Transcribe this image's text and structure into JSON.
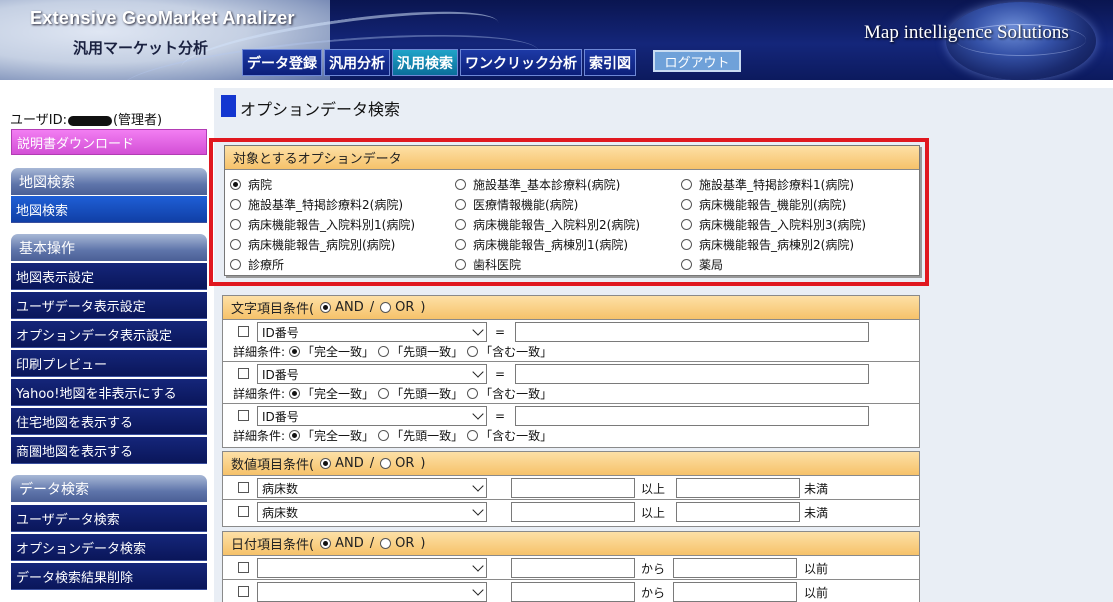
{
  "header": {
    "app_title": "Extensive GeoMarket Analizer",
    "app_subtitle": "汎用マーケット分析",
    "brand": "Map intelligence Solutions",
    "logout": "ログアウト",
    "tabs": [
      {
        "label": "データ登録"
      },
      {
        "label": "汎用分析"
      },
      {
        "label": "汎用検索"
      },
      {
        "label": "ワンクリック分析"
      },
      {
        "label": "索引図"
      }
    ],
    "active_tab": "汎用検索"
  },
  "sidebar": {
    "user_prefix": "ユーザID:",
    "user_suffix": "(管理者)",
    "manual_download": "説明書ダウンロード",
    "sections": [
      {
        "title": "地図検索",
        "items": [
          "地図検索"
        ]
      },
      {
        "title": "基本操作",
        "items": [
          "地図表示設定",
          "ユーザデータ表示設定",
          "オプションデータ表示設定",
          "印刷プレビュー",
          "Yahoo!地図を非表示にする",
          "住宅地図を表示する",
          "商圏地図を表示する"
        ]
      },
      {
        "title": "データ検索",
        "items": [
          "ユーザデータ検索",
          "オプションデータ検索",
          "データ検索結果削除"
        ]
      }
    ]
  },
  "main": {
    "page_title": "オプションデータ検索",
    "option_panel": {
      "title": "対象とするオプションデータ",
      "selected": "病院",
      "options": [
        "病院",
        "施設基準_基本診療料(病院)",
        "施設基準_特掲診療料1(病院)",
        "施設基準_特掲診療料2(病院)",
        "医療情報機能(病院)",
        "病床機能報告_機能別(病院)",
        "病床機能報告_入院料別1(病院)",
        "病床機能報告_入院料別2(病院)",
        "病床機能報告_入院料別3(病院)",
        "病床機能報告_病院別(病院)",
        "病床機能報告_病棟別1(病院)",
        "病床機能報告_病棟別2(病院)",
        "診療所",
        "歯科医院",
        "薬局"
      ]
    },
    "text_conditions": {
      "title": "文字項目条件(",
      "and": "AND",
      "sep": "/",
      "or": "OR",
      "close": ")",
      "logic_selected": "AND",
      "equals": "=",
      "detail_label": "詳細条件:",
      "detail_options": [
        "「完全一致」",
        "「先頭一致」",
        "「含む一致」"
      ],
      "rows": [
        {
          "field": "ID番号",
          "value": "",
          "detail_selected": "「完全一致」"
        },
        {
          "field": "ID番号",
          "value": "",
          "detail_selected": "「完全一致」"
        },
        {
          "field": "ID番号",
          "value": "",
          "detail_selected": "「完全一致」"
        }
      ]
    },
    "numeric_conditions": {
      "title": "数値項目条件(",
      "and": "AND",
      "sep": "/",
      "or": "OR",
      "close": ")",
      "logic_selected": "AND",
      "rows": [
        {
          "field": "病床数",
          "min": "",
          "min_label": "以上",
          "max": "",
          "max_label": "未満"
        },
        {
          "field": "病床数",
          "min": "",
          "min_label": "以上",
          "max": "",
          "max_label": "未満"
        }
      ]
    },
    "date_conditions": {
      "title": "日付項目条件(",
      "and": "AND",
      "sep": "/",
      "or": "OR",
      "close": ")",
      "logic_selected": "AND",
      "rows": [
        {
          "field": "",
          "from": "",
          "from_label": "から",
          "to": "",
          "to_label": "以前"
        },
        {
          "field": "",
          "from": "",
          "from_label": "から",
          "to": "",
          "to_label": "以前"
        }
      ]
    }
  }
}
